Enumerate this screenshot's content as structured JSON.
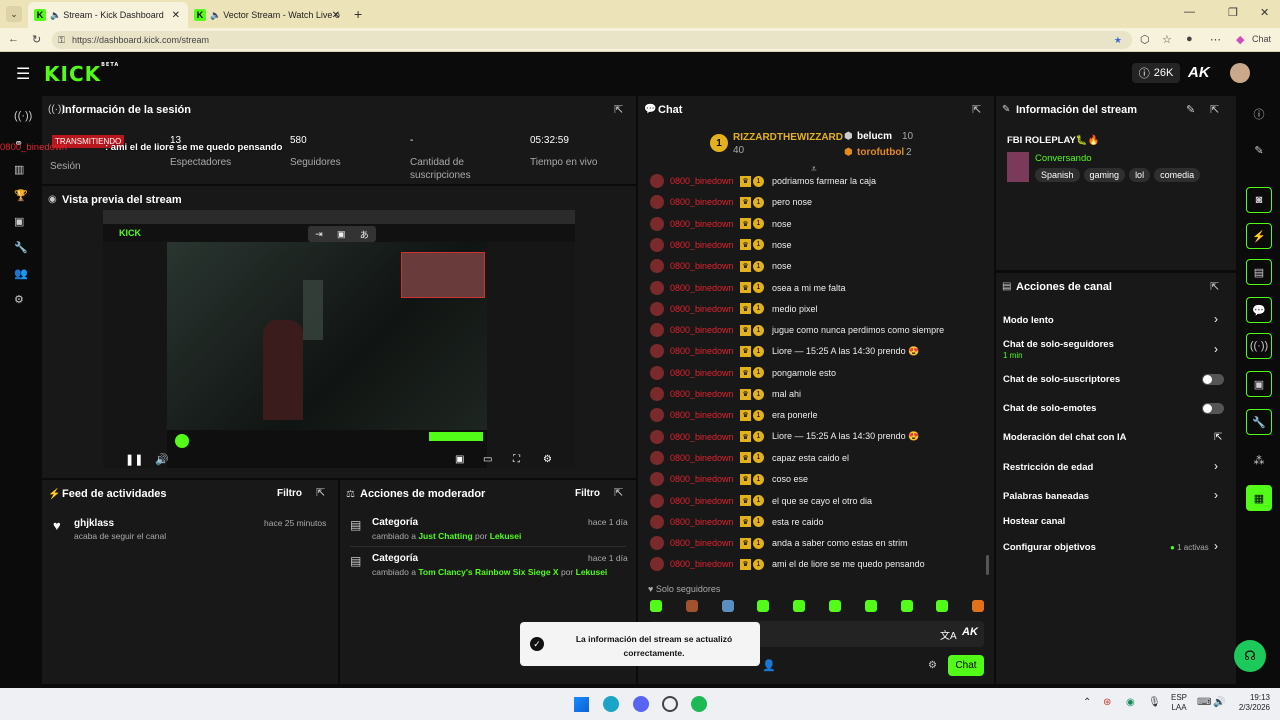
{
  "browser": {
    "tabs": [
      {
        "title": "Stream - Kick Dashboard"
      },
      {
        "title": "Vector Stream - Watch Live o"
      }
    ],
    "url": "https://dashboard.kick.com/stream",
    "chat_label": "Chat"
  },
  "topnav": {
    "logo": "KICK",
    "beta": "BETA",
    "count": "26K"
  },
  "session": {
    "title": "Información de la sesión",
    "status": "TRANSMITIENDO",
    "session_label": "Sesión",
    "viewers": "13",
    "viewers_label": "Espectadores",
    "followers": "580",
    "followers_label": "Seguidores",
    "subs": "-",
    "subs_label": "Cantidad de suscripciones",
    "live_time": "05:32:59",
    "live_label": "Tiempo en vivo",
    "overlay_user": "0800_binedown",
    "overlay_msg": ": ami el de liore se me quedo pensando"
  },
  "preview": {
    "title": "Vista previa del stream"
  },
  "feed": {
    "title": "Feed de actividades",
    "filter": "Filtro",
    "items": [
      {
        "user": "ghjklass",
        "action": "acaba de seguir el canal",
        "time": "hace 25 minutos"
      }
    ]
  },
  "mod": {
    "title": "Acciones de moderador",
    "filter": "Filtro",
    "items": [
      {
        "title": "Categoría",
        "changed": "cambiado a",
        "value": "Just Chatting",
        "by": "por",
        "user": "Lekusei",
        "time": "hace 1 día"
      },
      {
        "title": "Categoría",
        "changed": "cambiado a",
        "value": "Tom Clancy's Rainbow Six Siege X",
        "by": "por",
        "user": "Lekusei",
        "time": "hace 1 día"
      }
    ]
  },
  "chat": {
    "title": "Chat",
    "top": [
      {
        "rank": "1",
        "name": "RIZZARDTHEWIZZARD",
        "amount": "40"
      },
      {
        "name": "belucm",
        "amount": "10"
      },
      {
        "name": "torofutbol",
        "amount": "2"
      }
    ],
    "messages": [
      {
        "user": "0800_binedown",
        "text": "podriamos farmear la caja"
      },
      {
        "user": "0800_binedown",
        "text": "pero nose"
      },
      {
        "user": "0800_binedown",
        "text": "nose"
      },
      {
        "user": "0800_binedown",
        "text": "nose"
      },
      {
        "user": "0800_binedown",
        "text": "nose"
      },
      {
        "user": "0800_binedown",
        "text": "osea a mi me falta"
      },
      {
        "user": "0800_binedown",
        "text": "medio pixel"
      },
      {
        "user": "0800_binedown",
        "text": "jugue como nunca perdimos como siempre"
      },
      {
        "user": "0800_binedown",
        "text": "Liore — 15:25 A las 14:30 prendo 😍"
      },
      {
        "user": "0800_binedown",
        "text": "pongamole esto"
      },
      {
        "user": "0800_binedown",
        "text": "mal ahi"
      },
      {
        "user": "0800_binedown",
        "text": "era ponerle"
      },
      {
        "user": "0800_binedown",
        "text": "Liore — 15:25 A las 14:30 prendo 😍"
      },
      {
        "user": "0800_binedown",
        "text": "capaz esta caido el"
      },
      {
        "user": "0800_binedown",
        "text": "coso ese"
      },
      {
        "user": "0800_binedown",
        "text": "el que se cayo el otro dia"
      },
      {
        "user": "0800_binedown",
        "text": "esta re caido"
      },
      {
        "user": "0800_binedown",
        "text": "anda a saber como estas en strim"
      },
      {
        "user": "0800_binedown",
        "text": "ami el de liore se me quedo pensando"
      }
    ],
    "followers_only": "Solo seguidores",
    "send": "Chat"
  },
  "toast": {
    "line1": "La información del stream se actualizó",
    "line2": "correctamente."
  },
  "stream_info": {
    "title": "Información del stream",
    "stream_title": "FBI ROLEPLAY🐛🔥",
    "category": "Conversando",
    "tags": [
      "Spanish",
      "gaming",
      "lol",
      "comedia"
    ]
  },
  "actions": {
    "title": "Acciones de canal",
    "rows": [
      {
        "label": "Modo lento"
      },
      {
        "label": "Chat de solo-seguidores",
        "sub": "1 min"
      },
      {
        "label": "Chat de solo-suscriptores"
      },
      {
        "label": "Chat de solo-emotes"
      },
      {
        "label": "Moderación del chat con IA"
      },
      {
        "label": "Restricción de edad"
      },
      {
        "label": "Palabras baneadas"
      },
      {
        "label": "Hostear canal"
      },
      {
        "label": "Configurar objetivos",
        "extra": "1 activas"
      }
    ]
  },
  "taskbar": {
    "lang1": "ESP",
    "lang2": "LAA",
    "time": "19:13",
    "date": "2/3/2026"
  },
  "colors": {
    "accent": "#53fc18",
    "panel": "#181818",
    "chat_user": "#e0232e"
  }
}
